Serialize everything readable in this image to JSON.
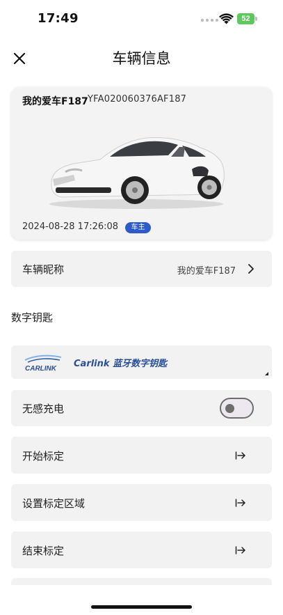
{
  "status_bar": {
    "time": "17:49",
    "battery": "52"
  },
  "header": {
    "title": "车辆信息",
    "close_icon": "close-icon"
  },
  "car": {
    "name": "我的爱车F187",
    "vin": "YFA020060376AF187",
    "date": "2024-08-28 17:26:08",
    "role_badge": "车主",
    "badge_color": "#2d5bc7"
  },
  "nickname_row": {
    "label": "车辆昵称",
    "value": "我的爱车F187"
  },
  "digital_key": {
    "section_title": "数字钥匙",
    "logo_text": "CARLINK",
    "title": "Carlink 蓝牙数字钥匙"
  },
  "wireless_charging": {
    "label": "无感充电",
    "enabled": false
  },
  "actions": [
    {
      "label": "开始标定"
    },
    {
      "label": "设置标定区域"
    },
    {
      "label": "结束标定"
    }
  ]
}
